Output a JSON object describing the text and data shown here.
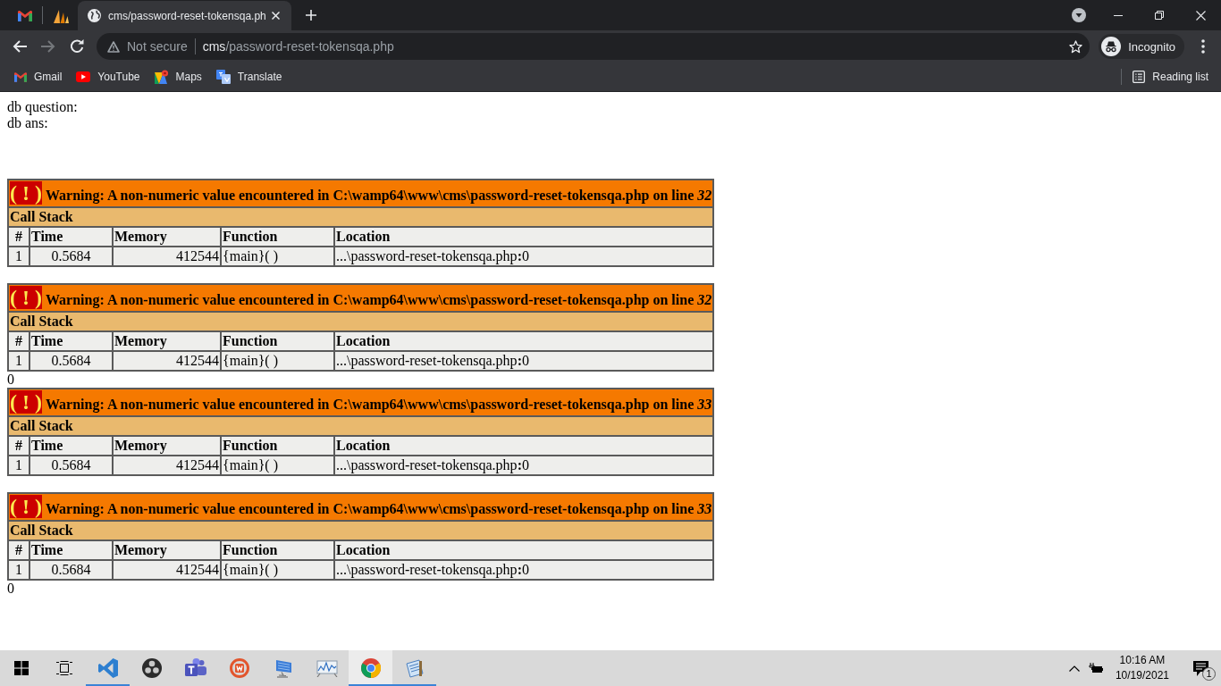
{
  "browser": {
    "tabs": [
      {
        "kind": "pinned",
        "selected": false
      },
      {
        "kind": "pinned",
        "selected": false
      },
      {
        "kind": "page",
        "title": "cms/password-reset-tokensqa.ph",
        "selected": true
      }
    ],
    "nav": {
      "back_disabled": false,
      "forward_disabled": true
    },
    "address_bar": {
      "security": "Not secure",
      "host": "cms",
      "path": "/password-reset-tokensqa.php"
    },
    "profile": {
      "label": "Incognito"
    },
    "bookmarks": [
      {
        "label": "Gmail"
      },
      {
        "label": "YouTube"
      },
      {
        "label": "Maps"
      },
      {
        "label": "Translate"
      }
    ],
    "reading_list": "Reading list"
  },
  "page": {
    "intro": [
      "db question:",
      "db ans:"
    ],
    "blocks": [
      {
        "kind": "warning",
        "sign": "( ! )",
        "message": "Warning: A non-numeric value encountered in C:\\wamp64\\www\\cms\\password-reset-tokensqa.php on line *32*",
        "stack_title": "Call Stack",
        "columns": [
          "#",
          "Time",
          "Memory",
          "Function",
          "Location"
        ],
        "rows": [
          [
            "1",
            "0.5684",
            "412544",
            "{main}( )",
            "...\\password-reset-tokensqa.php**:**0"
          ]
        ]
      },
      {
        "kind": "warning",
        "sign": "( ! )",
        "message": "Warning: A non-numeric value encountered in C:\\wamp64\\www\\cms\\password-reset-tokensqa.php on line *32*",
        "stack_title": "Call Stack",
        "columns": [
          "#",
          "Time",
          "Memory",
          "Function",
          "Location"
        ],
        "rows": [
          [
            "1",
            "0.5684",
            "412544",
            "{main}( )",
            "...\\password-reset-tokensqa.php**:**0"
          ]
        ]
      },
      {
        "kind": "text",
        "text": "0"
      },
      {
        "kind": "warning",
        "sign": "( ! )",
        "message": "Warning: A non-numeric value encountered in C:\\wamp64\\www\\cms\\password-reset-tokensqa.php on line *33*",
        "stack_title": "Call Stack",
        "columns": [
          "#",
          "Time",
          "Memory",
          "Function",
          "Location"
        ],
        "rows": [
          [
            "1",
            "0.5684",
            "412544",
            "{main}( )",
            "...\\password-reset-tokensqa.php**:**0"
          ]
        ]
      },
      {
        "kind": "warning",
        "sign": "( ! )",
        "message": "Warning: A non-numeric value encountered in C:\\wamp64\\www\\cms\\password-reset-tokensqa.php on line *33*",
        "stack_title": "Call Stack",
        "columns": [
          "#",
          "Time",
          "Memory",
          "Function",
          "Location"
        ],
        "rows": [
          [
            "1",
            "0.5684",
            "412544",
            "{main}( )",
            "...\\password-reset-tokensqa.php**:**0"
          ]
        ]
      },
      {
        "kind": "text",
        "text": "0"
      }
    ]
  },
  "taskbar": {
    "apps": [
      {
        "running": true,
        "selected": false
      },
      {
        "running": false,
        "selected": false
      },
      {
        "running": false,
        "selected": false
      },
      {
        "running": false,
        "selected": false
      },
      {
        "running": false,
        "selected": false
      },
      {
        "running": false,
        "selected": false
      },
      {
        "running": true,
        "selected": true
      },
      {
        "running": true,
        "selected": false
      }
    ],
    "clock": {
      "time": "10:16 AM",
      "date": "10/19/2021"
    },
    "notifications": "1"
  }
}
